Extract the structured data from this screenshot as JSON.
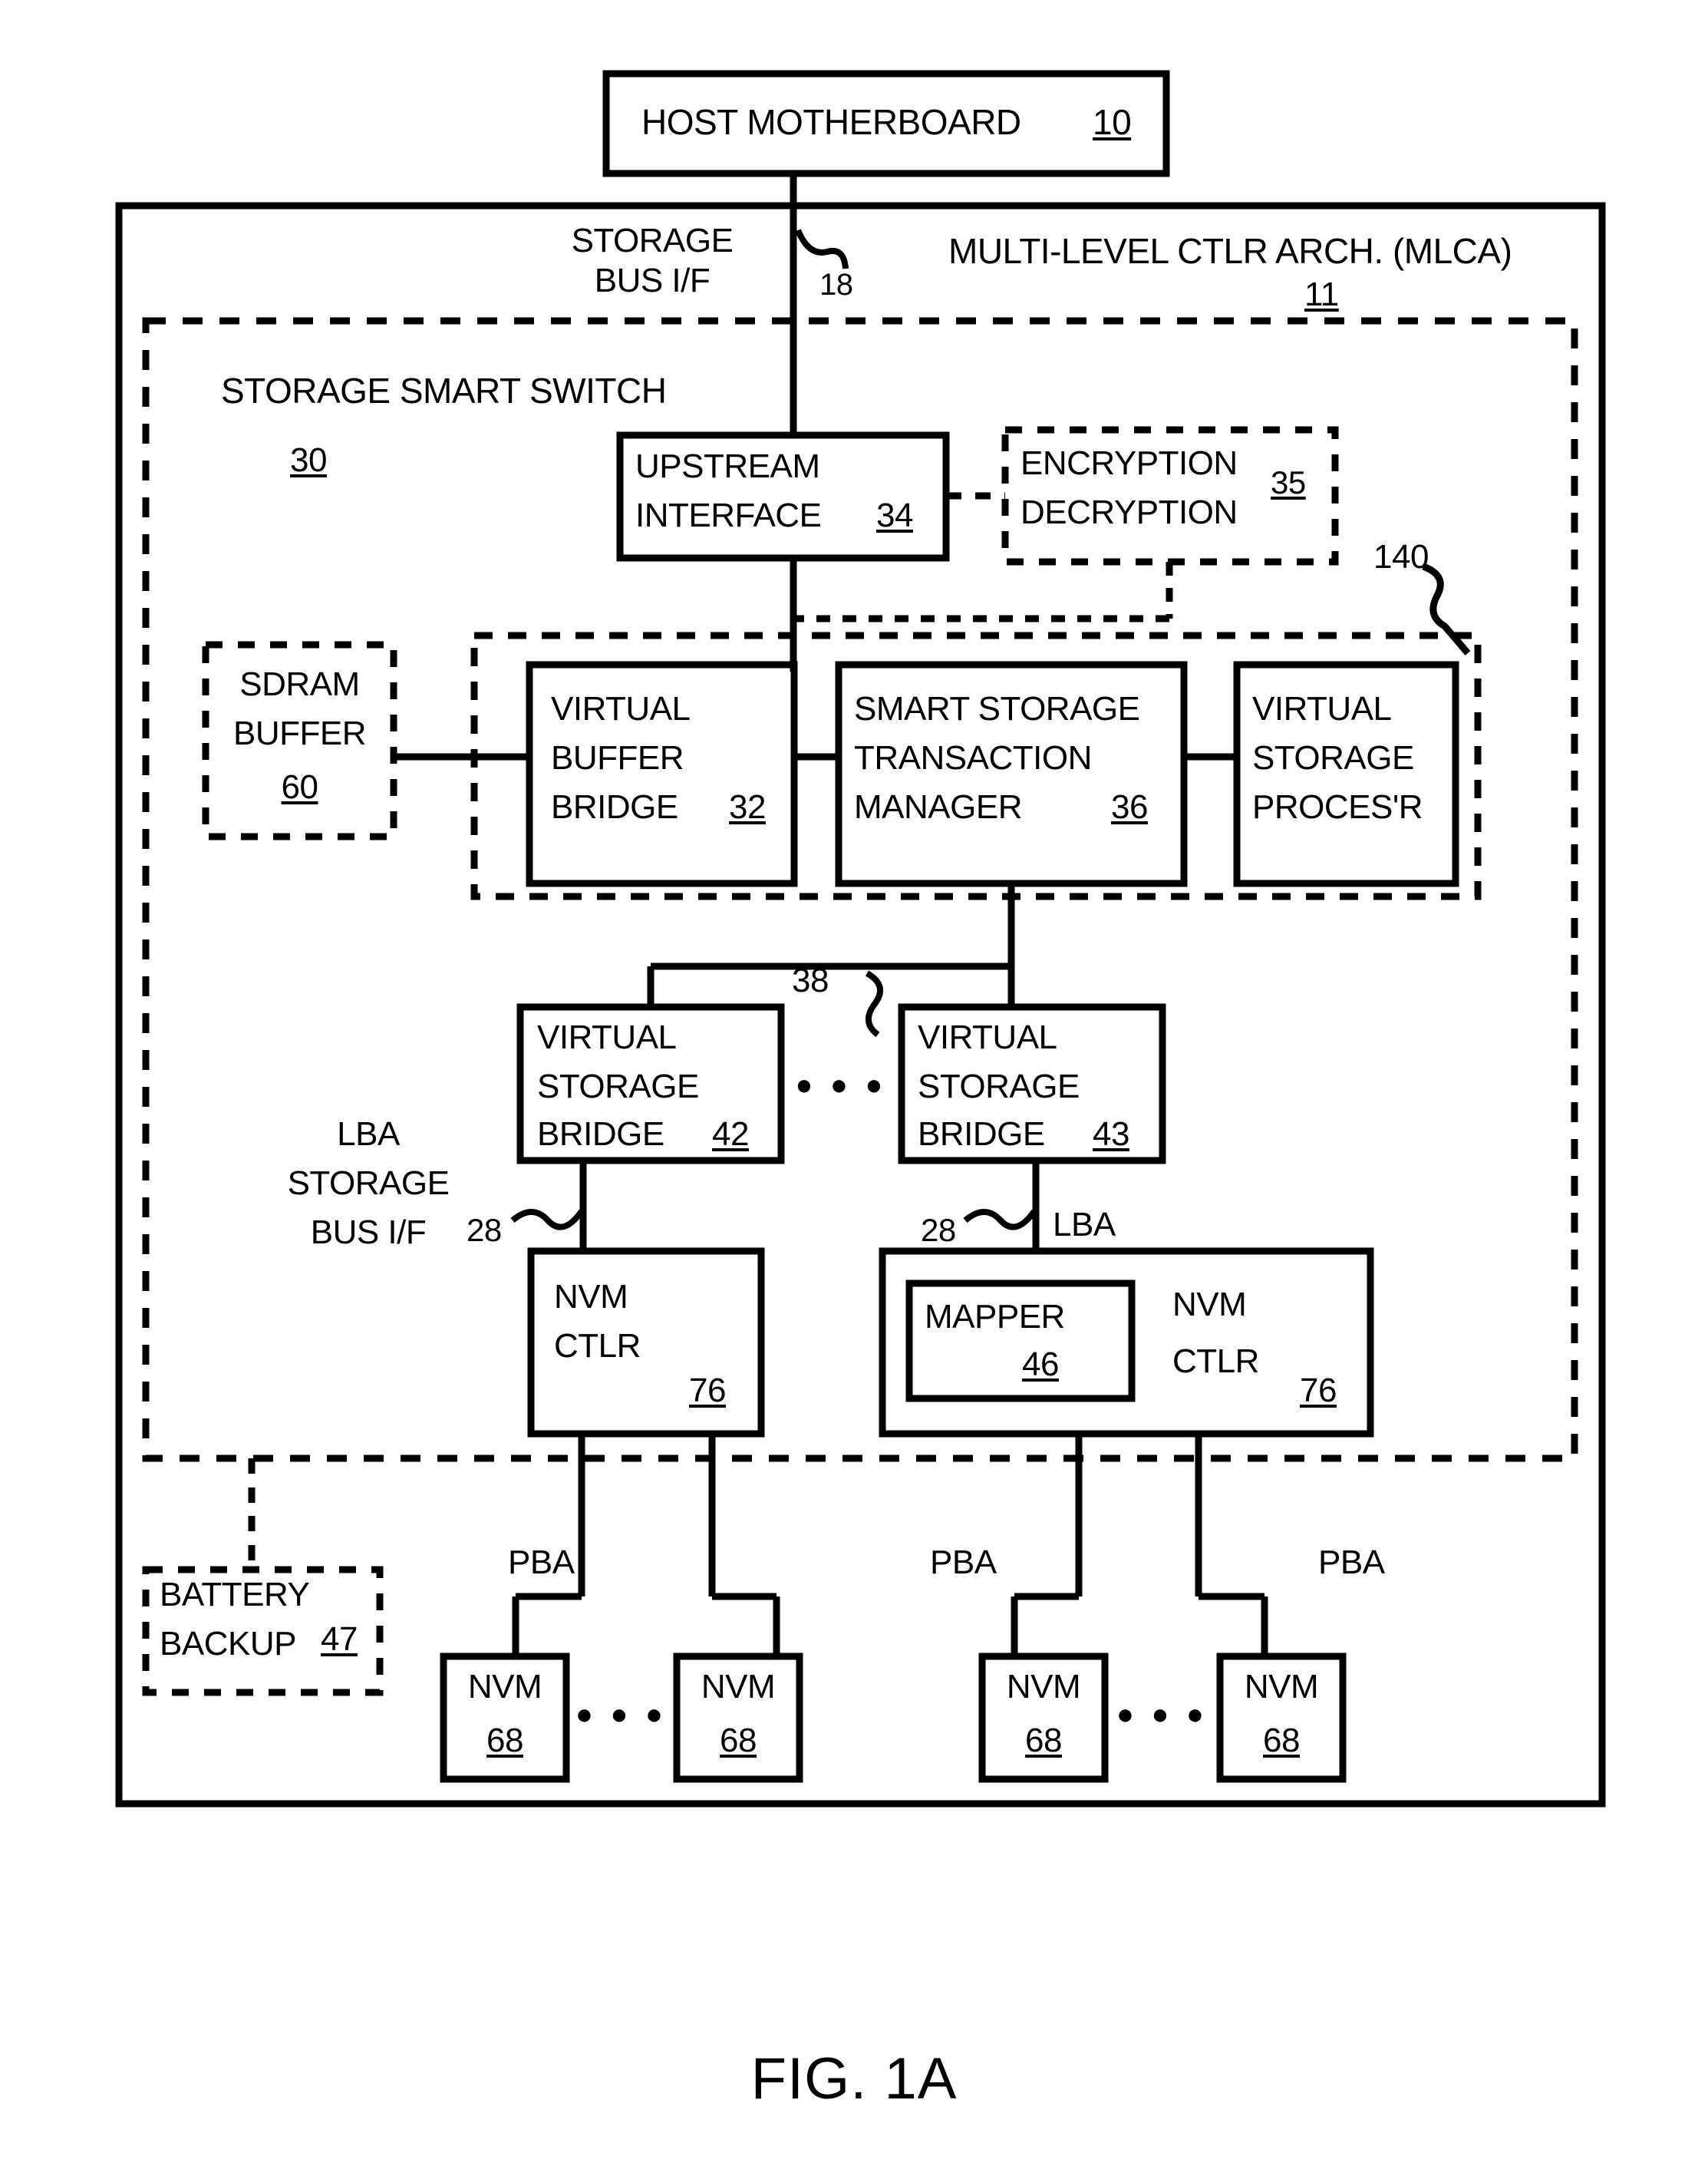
{
  "figure": {
    "caption": "FIG. 1A",
    "title_block": {
      "label": "HOST MOTHERBOARD",
      "ref": "10"
    },
    "outer": {
      "label": "MULTI-LEVEL CTLR ARCH. (MLCA)",
      "ref": "11"
    },
    "bus_host": {
      "line1": "STORAGE",
      "line2": "BUS I/F",
      "ref": "18"
    },
    "switch": {
      "label": "STORAGE SMART SWITCH",
      "ref": "30"
    },
    "upstream": {
      "line1": "UPSTREAM",
      "line2": "INTERFACE",
      "ref": "34"
    },
    "encryption": {
      "line1": "ENCRYPTION",
      "line2": "DECRYPTION",
      "ref": "35"
    },
    "sdram": {
      "line1": "SDRAM",
      "line2": "BUFFER",
      "ref": "60"
    },
    "vbb": {
      "line1": "VIRTUAL",
      "line2": "BUFFER",
      "line3": "BRIDGE",
      "ref": "32"
    },
    "sstm": {
      "line1": "SMART STORAGE",
      "line2": "TRANSACTION",
      "line3": "MANAGER",
      "ref": "36"
    },
    "vsp": {
      "line1": "VIRTUAL",
      "line2": "STORAGE",
      "line3": "PROCES'R"
    },
    "inner_group_ref": "140",
    "internal_bus_ref": "38",
    "vsb_left": {
      "line1": "VIRTUAL",
      "line2": "STORAGE",
      "line3": "BRIDGE",
      "ref": "42"
    },
    "vsb_right": {
      "line1": "VIRTUAL",
      "line2": "STORAGE",
      "line3": "BRIDGE",
      "ref": "43"
    },
    "lba_bus": {
      "line1": "LBA",
      "line2": "STORAGE",
      "line3": "BUS I/F",
      "ref": "28"
    },
    "lba_right": {
      "ref": "28",
      "label": "LBA"
    },
    "nvm_ctlr_left": {
      "line1": "NVM",
      "line2": "CTLR",
      "ref": "76"
    },
    "nvm_ctlr_right": {
      "line1": "NVM",
      "line2": "CTLR",
      "ref": "76"
    },
    "mapper": {
      "label": "MAPPER",
      "ref": "46"
    },
    "battery": {
      "line1": "BATTERY",
      "line2": "BACKUP",
      "ref": "47"
    },
    "pba_labels": [
      "PBA",
      "PBA",
      "PBA"
    ],
    "nvm_chips": [
      {
        "label": "NVM",
        "ref": "68"
      },
      {
        "label": "NVM",
        "ref": "68"
      },
      {
        "label": "NVM",
        "ref": "68"
      },
      {
        "label": "NVM",
        "ref": "68"
      }
    ],
    "ellipsis": "● ● ●",
    "colors": {
      "stroke": "#000000",
      "background": "#ffffff"
    }
  }
}
